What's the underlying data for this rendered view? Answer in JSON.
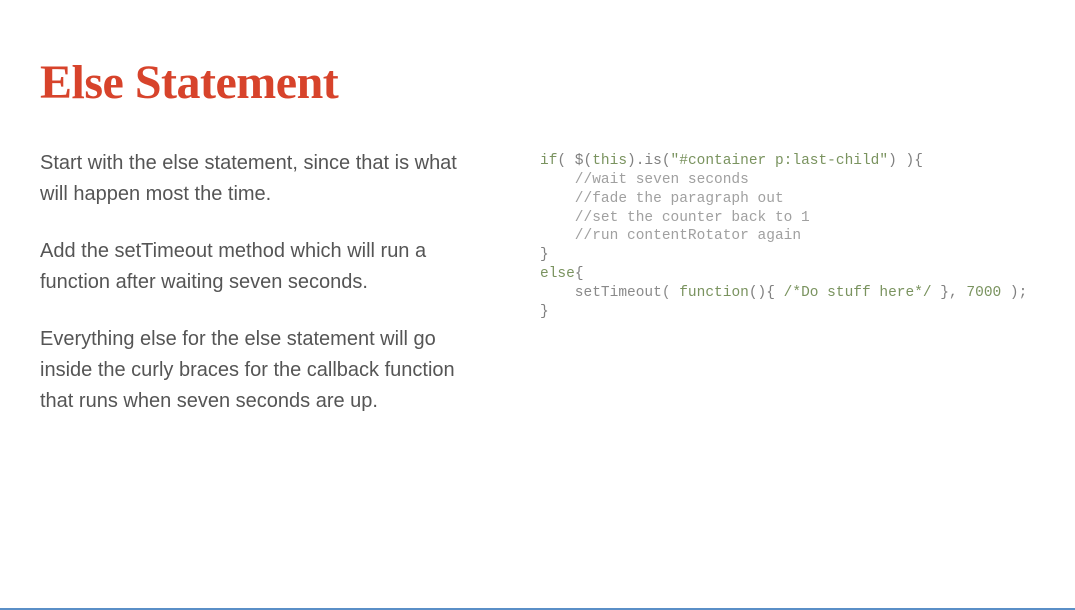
{
  "title": "Else Statement",
  "paragraphs": [
    "Start with the else statement, since that is what will happen most the time.",
    "Add the setTimeout method which will run a function after waiting seven seconds.",
    "Everything else for the else statement will go inside the curly braces for the callback function that runs when seven seconds are up."
  ],
  "code": {
    "line1_if": "if",
    "line1_open": "( $(",
    "line1_this": "this",
    "line1_mid1": ").is(",
    "line1_str": "\"#container p:last-child\"",
    "line1_mid2": ") ){",
    "line2": "    //wait seven seconds",
    "line3": "    //fade the paragraph out",
    "line4": "    //set the counter back to 1",
    "line5": "    //run contentRotator again",
    "line6": "}",
    "line7_else": "else",
    "line7_brace": "{",
    "line8_indent": "    setTimeout( ",
    "line8_function": "function",
    "line8_mid": "(){ ",
    "line8_comment": "/*Do stuff here*/",
    "line8_mid2": " }, ",
    "line8_num": "7000",
    "line8_end": " );",
    "line9": "}"
  }
}
